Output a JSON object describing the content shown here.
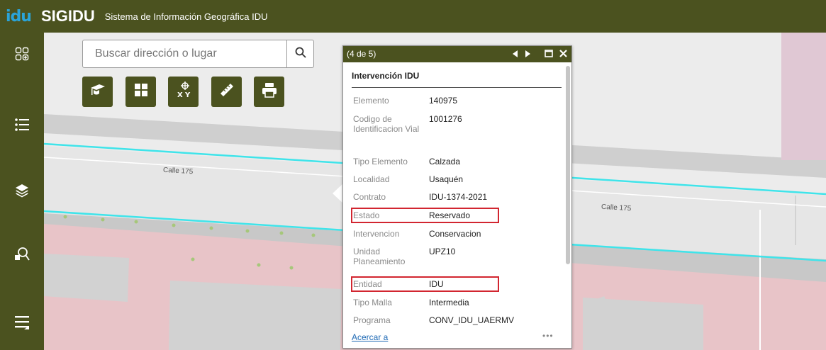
{
  "header": {
    "logo_text": "idu",
    "app_name": "SIGIDU",
    "app_subtitle": "Sistema de Información Geográfica IDU"
  },
  "sidebar": {
    "items": [
      {
        "icon": "widgets-icon"
      },
      {
        "icon": "legend-list-icon"
      },
      {
        "icon": "layers-icon"
      },
      {
        "icon": "query-search-icon"
      },
      {
        "icon": "menu-icon"
      }
    ]
  },
  "search": {
    "placeholder": "Buscar dirección o lugar",
    "value": ""
  },
  "tools": [
    {
      "icon": "graduation-cap-icon"
    },
    {
      "icon": "grid-icon"
    },
    {
      "icon": "coordinates-xy-icon"
    },
    {
      "icon": "ruler-measure-icon"
    },
    {
      "icon": "print-icon"
    }
  ],
  "map": {
    "street_labels": [
      "Calle 175",
      "Calle 175"
    ]
  },
  "popup": {
    "counter": "(4 de 5)",
    "title": "Intervención IDU",
    "attributes": [
      {
        "label": "Elemento",
        "value": "140975"
      },
      {
        "label": "Codigo de Identificacion Vial",
        "value": "1001276"
      },
      {
        "label": "Tipo Elemento",
        "value": "Calzada"
      },
      {
        "label": "Localidad",
        "value": "Usaquén"
      },
      {
        "label": "Contrato",
        "value": "IDU-1374-2021"
      },
      {
        "label": "Estado",
        "value": "Reservado",
        "highlighted": true
      },
      {
        "label": "Intervencion",
        "value": "Conservacion"
      },
      {
        "label": "Unidad Planeamiento",
        "value": "UPZ10"
      },
      {
        "label": "Entidad",
        "value": "IDU",
        "highlighted": true
      },
      {
        "label": "Tipo Malla",
        "value": "Intermedia"
      },
      {
        "label": "Programa",
        "value": "CONV_IDU_UAERMV"
      }
    ],
    "zoom_link": "Acercar a",
    "more_label": "•••"
  },
  "colors": {
    "brand": "#4b521f",
    "highlight": "#d22630",
    "road_edge": "#3fe4ea",
    "block": "#e8c4c8",
    "link": "#1f6ab5"
  }
}
